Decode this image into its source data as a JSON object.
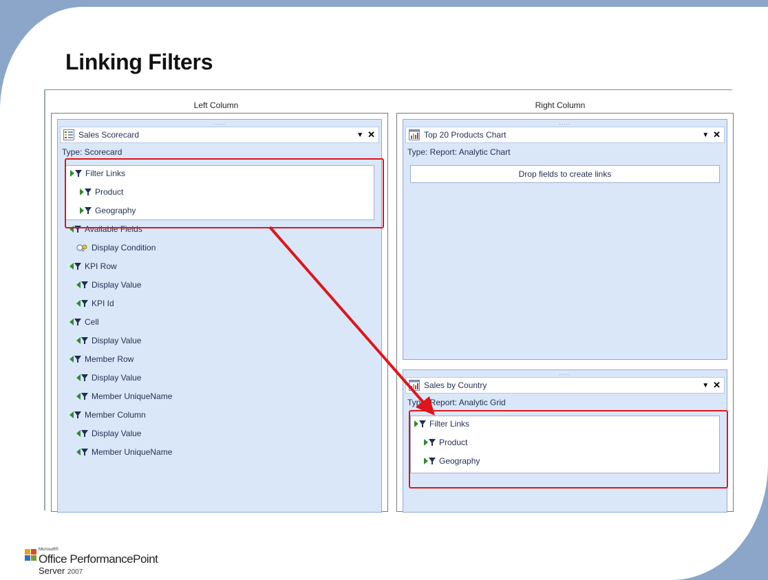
{
  "slide": {
    "title": "Linking Filters"
  },
  "columns": {
    "left_label": "Left Column",
    "right_label": "Right Column"
  },
  "scorecard_part": {
    "handle": ".....",
    "title": "Sales Scorecard",
    "type": "Type:  Scorecard",
    "filter_links": [
      "Filter Links",
      "Product",
      "Geography"
    ],
    "available_fields": [
      {
        "label": "Available Fields",
        "icon": "field-icon"
      },
      {
        "label": "Display Condition",
        "icon": "display-condition-icon"
      },
      {
        "label": "KPI Row",
        "icon": "field-icon"
      },
      {
        "label": "Display Value",
        "icon": "field-icon"
      },
      {
        "label": "KPI Id",
        "icon": "field-icon"
      },
      {
        "label": "Cell",
        "icon": "field-icon"
      },
      {
        "label": "Display Value",
        "icon": "field-icon"
      },
      {
        "label": "Member Row",
        "icon": "field-icon"
      },
      {
        "label": "Display Value",
        "icon": "field-icon"
      },
      {
        "label": "Member UniqueName",
        "icon": "field-icon"
      },
      {
        "label": "Member Column",
        "icon": "field-icon"
      },
      {
        "label": "Display Value",
        "icon": "field-icon"
      },
      {
        "label": "Member UniqueName",
        "icon": "field-icon"
      }
    ]
  },
  "chart_part": {
    "handle": ".....",
    "title": "Top 20 Products Chart",
    "type": "Type:  Report: Analytic Chart",
    "drop_hint": "Drop fields to create links"
  },
  "grid_part": {
    "handle": ".....",
    "title": "Sales by Country",
    "type": "Type:  Report: Analytic Grid",
    "filter_links": [
      "Filter Links",
      "Product",
      "Geography"
    ]
  },
  "part_controls": {
    "menu": "▼",
    "close": "✕"
  },
  "logo": {
    "small": "Microsoft®",
    "main": "Office PerformancePoint",
    "server": "Server",
    "year": "2007"
  },
  "colors": {
    "highlight": "#e0141b",
    "arrow": "#e0141b",
    "part_bg": "#dae7f8",
    "slide_frame": "#8ba6c9"
  }
}
